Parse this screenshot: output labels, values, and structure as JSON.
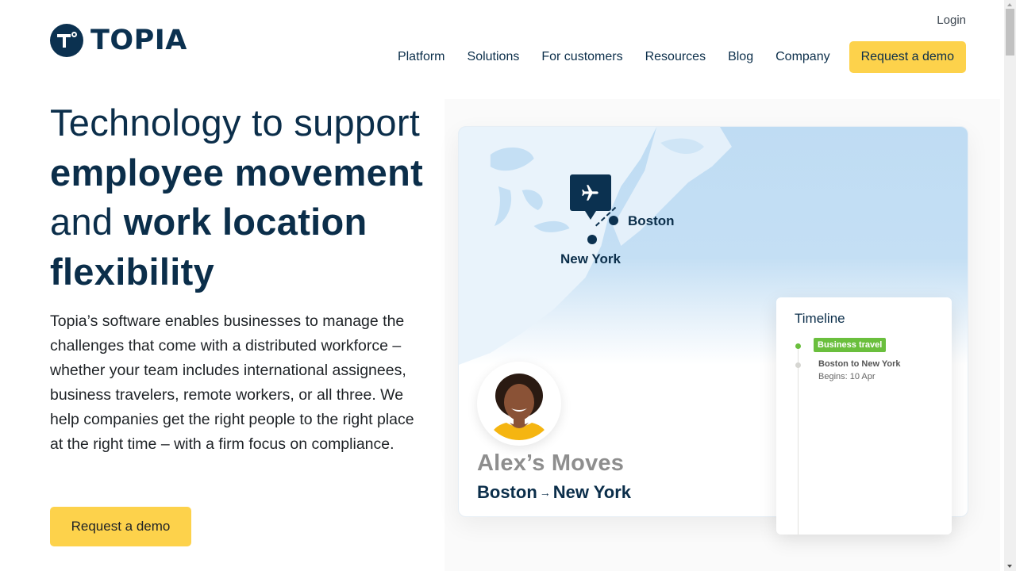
{
  "header": {
    "logo_text": "TOPIA",
    "login_label": "Login",
    "nav": [
      {
        "label": "Platform"
      },
      {
        "label": "Solutions"
      },
      {
        "label": "For customers"
      },
      {
        "label": "Resources"
      },
      {
        "label": "Blog"
      },
      {
        "label": "Company"
      }
    ],
    "cta_label": "Request a demo"
  },
  "hero": {
    "headline": {
      "part1": "Technology to support ",
      "bold1": "employee movement",
      "part2": " and ",
      "bold2": "work location flexibility"
    },
    "description": "Topia’s software enables businesses to manage the challenges that come with a distributed workforce – whether your team includes international assignees, business travelers, remote workers, or all three. We help companies get the right people to the right place at the right time – with a firm focus on compliance.",
    "cta_label": "Request a demo"
  },
  "graphic": {
    "map": {
      "origin_city": "Boston",
      "destination_city": "New York",
      "pin_icon": "airplane-icon"
    },
    "profile": {
      "title": "Alex’s Moves",
      "route_from": "Boston",
      "route_arrow": "→",
      "route_to": "New York"
    },
    "timeline": {
      "title": "Timeline",
      "items": [
        {
          "badge": "Business travel",
          "route": "Boston to New York",
          "begins": "Begins: 10 Apr"
        }
      ]
    }
  },
  "colors": {
    "brand_navy": "#0b3150",
    "cta_yellow": "#fdd24b",
    "badge_green": "#6abf3d",
    "map_blue": "#bfdcf3"
  }
}
